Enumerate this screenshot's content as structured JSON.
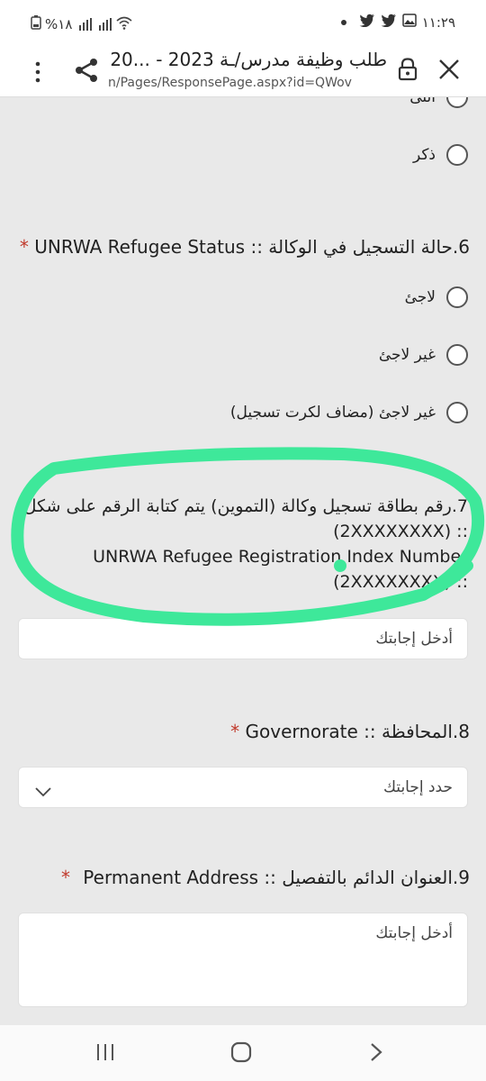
{
  "status_bar": {
    "battery": "%١٨",
    "time": "١١:٢٩"
  },
  "browser": {
    "title": "طلب وظيفة مدرس/ـة 2023 - ...20",
    "url": "n/Pages/ResponsePage.aspx?id=QWov"
  },
  "form": {
    "gender_options": [
      "أنثى",
      "ذكر"
    ],
    "q6": {
      "number": "6.",
      "label": "حالة التسجيل في الوكالة :: UNRWA Refugee Status",
      "required_mark": "*",
      "options": [
        "لاجئ",
        "غير لاجئ",
        "غير لاجئ (مضاف لكرت تسجيل)"
      ]
    },
    "q7": {
      "number": "7.",
      "label_line1": "رقم بطاقة تسجيل وكالة (التموين) يتم كتابة الرقم على شكل",
      "label_line2": ":: (2XXXXXXXX)",
      "label_line3": "UNRWA Refugee Registration Index Number",
      "label_line4": ":: (2XXXXXXXX)",
      "placeholder": "أدخل إجابتك"
    },
    "q8": {
      "number": "8.",
      "label": "المحافظة :: Governorate",
      "required_mark": "*",
      "placeholder": "حدد إجابتك"
    },
    "q9": {
      "number": "9.",
      "label": "العنوان الدائم بالتفصيل :: Permanent Address",
      "required_mark": "*",
      "placeholder": "أدخل إجابتك"
    }
  },
  "colors": {
    "highlight": "#3ee89a",
    "required": "#c0392b"
  }
}
